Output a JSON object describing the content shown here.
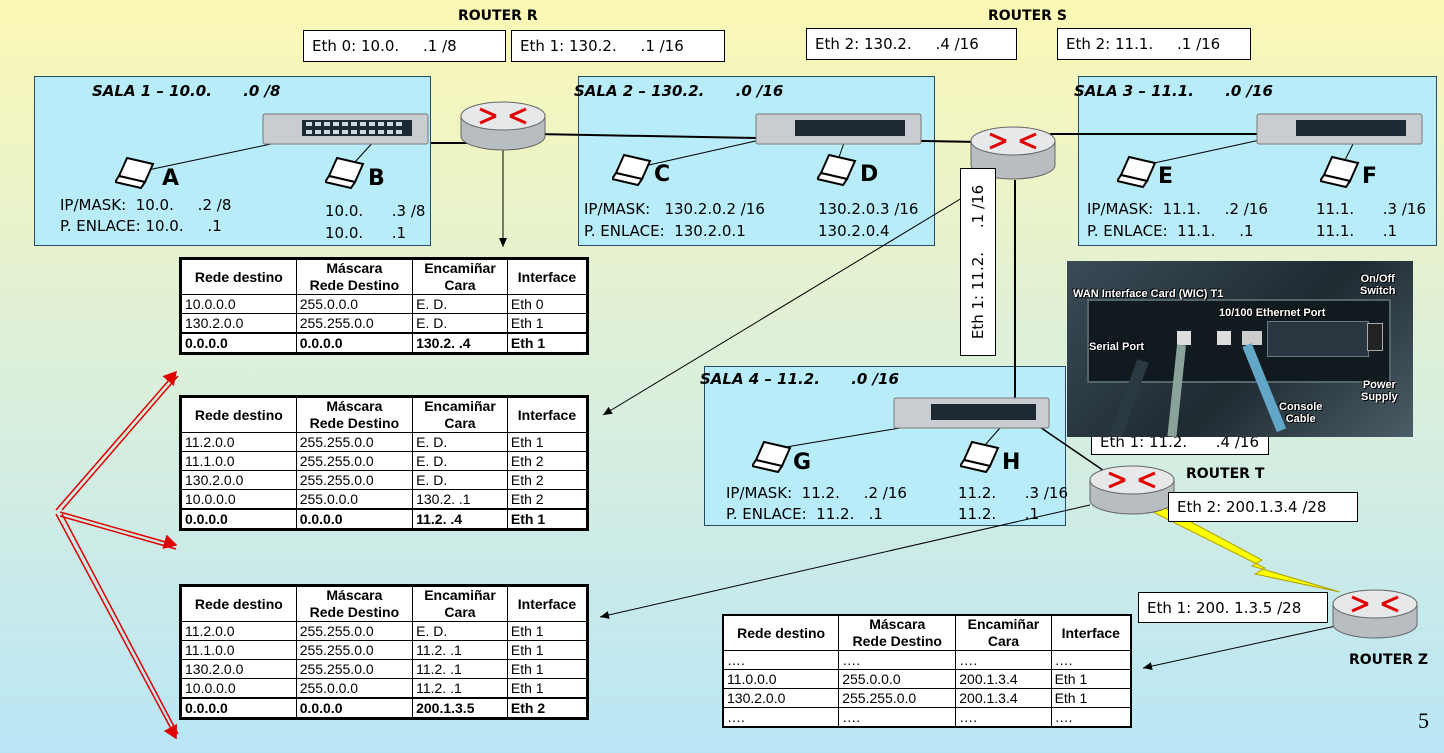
{
  "routers": {
    "r": {
      "name": "ROUTER R",
      "eth0": "Eth 0: 10.0.     .1 /8",
      "eth1": "Eth 1: 130.2.     .1 /16"
    },
    "s": {
      "name": "ROUTER S",
      "eth2a": "Eth 2: 130.2.     .4 /16",
      "eth2b": "Eth 2: 11.1.     .1 /16",
      "eth1": "Eth 1: 11.2.     .1 /16"
    },
    "t": {
      "name": "ROUTER T",
      "eth1": "Eth 1: 11.2.      .4 /16",
      "eth2": "Eth 2: 200.1.3.4 /28"
    },
    "z": {
      "name": "ROUTER Z",
      "eth1": "Eth 1: 200. 1.3.5 /28"
    }
  },
  "rooms": {
    "s1": {
      "title": "SALA 1 – 10.0.      .0 /8",
      "hostA": "A",
      "hostB": "B",
      "ipA": "IP/MASK:  10.0.     .2 /8",
      "gwA": "P. ENLACE: 10.0.     .1",
      "ipB": "10.0.      .3 /8",
      "gwB": "10.0.      .1"
    },
    "s2": {
      "title": "SALA 2 – 130.2.      .0 /16",
      "hostA": "C",
      "hostB": "D",
      "ipA": "IP/MASK:   130.2.0.2 /16",
      "gwA": "P. ENLACE:  130.2.0.1",
      "ipB": "130.2.0.3 /16",
      "gwB": "130.2.0.4"
    },
    "s3": {
      "title": "SALA 3 – 11.1.      .0 /16",
      "hostA": "E",
      "hostB": "F",
      "ipA": "IP/MASK:  11.1.     .2 /16",
      "gwA": "P. ENLACE:  11.1.     .1",
      "ipB": "11.1.      .3 /16",
      "gwB": "11.1.      .1"
    },
    "s4": {
      "title": "SALA 4 – 11.2.      .0 /16",
      "hostA": "G",
      "hostB": "H",
      "ipA": "IP/MASK:  11.2.     .2 /16",
      "gwA": "P. ENLACE:  11.2.   .1",
      "ipB": "11.2.      .3 /16",
      "gwB": "11.2.      .1"
    }
  },
  "photo": {
    "wic": "WAN Interface Card (WIC) T1",
    "onoff": "On/Off\nSwitch",
    "ethport": "10/100 Ethernet Port",
    "serial": "Serial Port",
    "console": "Console\nCable",
    "power": "Power\nSupply"
  },
  "headers": [
    "Rede destino",
    "Máscara\nRede Destino",
    "Encamiñar\nCara",
    "Interface"
  ],
  "tables": {
    "r": [
      [
        "10.0.0.0",
        "255.0.0.0",
        "E. D.",
        "Eth 0"
      ],
      [
        "130.2.0.0",
        "255.255.0.0",
        "E. D.",
        "Eth 1"
      ],
      [
        "0.0.0.0",
        "0.0.0.0",
        "130.2.     .4",
        "Eth 1"
      ]
    ],
    "s": [
      [
        "11.2.0.0",
        "255.255.0.0",
        "E. D.",
        "Eth 1"
      ],
      [
        "11.1.0.0",
        "255.255.0.0",
        "E. D.",
        "Eth 2"
      ],
      [
        "130.2.0.0",
        "255.255.0.0",
        "E. D.",
        "Eth 2"
      ],
      [
        "10.0.0.0",
        "255.0.0.0",
        "130.2.     .1",
        "Eth 2"
      ],
      [
        "0.0.0.0",
        "0.0.0.0",
        "11.2.     .4",
        "Eth 1"
      ]
    ],
    "t": [
      [
        "11.2.0.0",
        "255.255.0.0",
        "E. D.",
        "Eth 1"
      ],
      [
        "11.1.0.0",
        "255.255.0.0",
        "11.2.      .1",
        "Eth 1"
      ],
      [
        "130.2.0.0",
        "255.255.0.0",
        "11.2.      .1",
        "Eth 1"
      ],
      [
        "10.0.0.0",
        "255.0.0.0",
        "11.2.      .1",
        "Eth 1"
      ],
      [
        "0.0.0.0",
        "0.0.0.0",
        "200.1.3.5",
        "Eth 2"
      ]
    ],
    "z": [
      [
        "….",
        "….",
        "….",
        "…."
      ],
      [
        "11.0.0.0",
        "255.0.0.0",
        "200.1.3.4",
        "Eth 1"
      ],
      [
        "130.2.0.0",
        "255.255.0.0",
        "200.1.3.4",
        "Eth 1"
      ],
      [
        "….",
        "….",
        "….",
        "…."
      ]
    ]
  },
  "page_number": "5",
  "colors": {
    "room_fill": "#b8ecf8",
    "red_arrows": "#e00000",
    "link": "#ffff00"
  }
}
